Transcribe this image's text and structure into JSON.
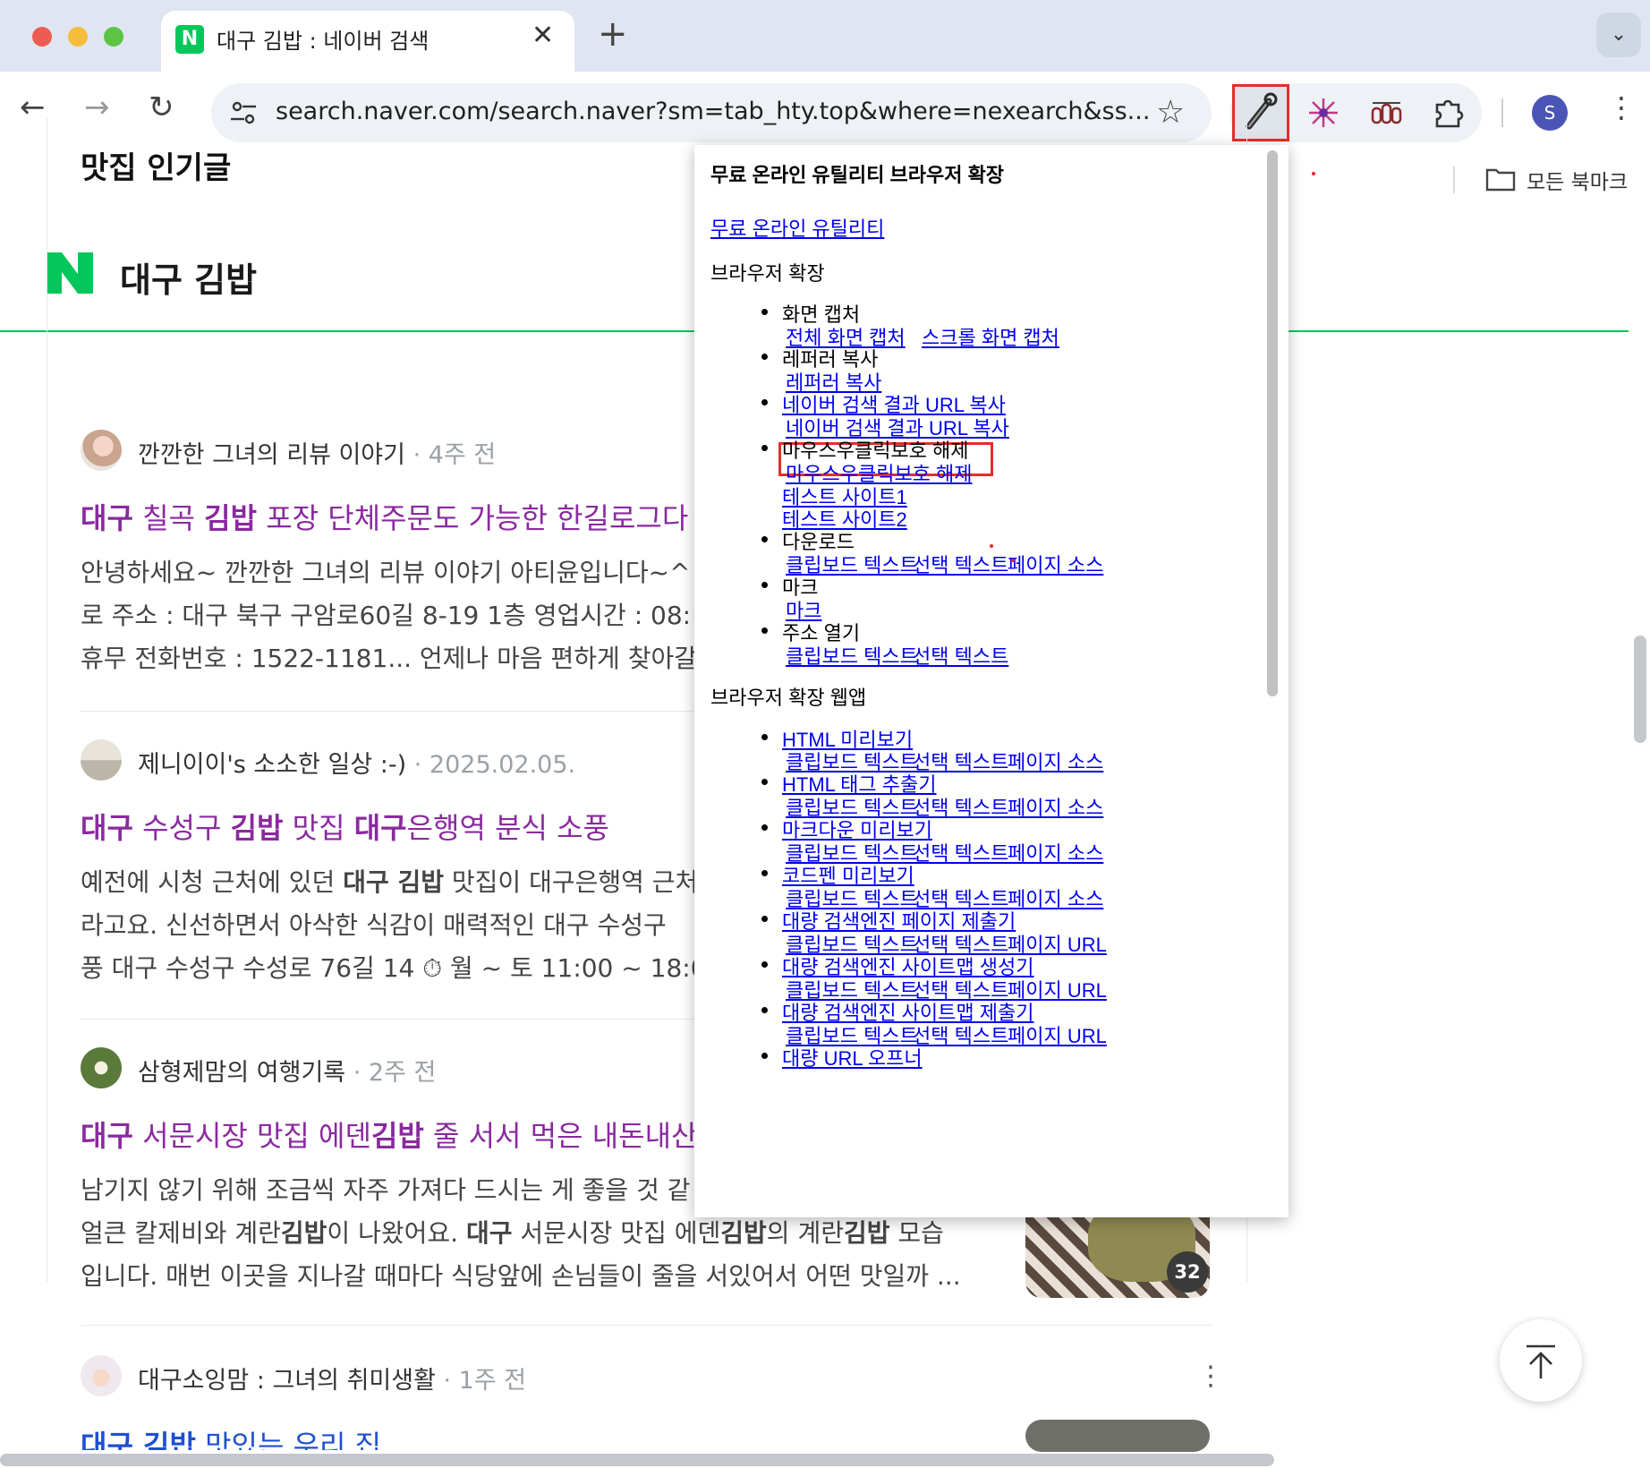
{
  "browser": {
    "tab": {
      "favicon": "N",
      "title": "대구 김밥 : 네이버 검색",
      "close": "✕"
    },
    "new_tab": "+",
    "tab_menu": "⌄",
    "nav": {
      "back": "←",
      "forward": "→",
      "reload": "↻"
    },
    "url": "search.naver.com/search.naver?sm=tab_hty.top&where=nexearch&ss...",
    "star": "☆",
    "profile_initial": "S",
    "menu": "⋮",
    "bookmarks_label": "모든 북마크"
  },
  "page": {
    "query": "대구 김밥",
    "section_title": "맛집 인기글",
    "posts": [
      {
        "author": "깐깐한 그녀의 리뷰 이야기",
        "time": " · 4주 전",
        "title_parts": [
          [
            "b",
            "대구"
          ],
          [
            "t",
            " 칠곡 "
          ],
          [
            "b",
            "김밥"
          ],
          [
            "t",
            " 포장 단체주문도 가능한 한길로그다"
          ]
        ],
        "desc": [
          "안녕하세요~ 깐깐한 그녀의 리뷰 이야기 아티윤입니다~^",
          "로 주소 : 대구 북구 구암로60길 8-19 1층 영업시간 : 08:",
          "휴무 전화번호 : 1522-1181... 언제나 마음 편하게 찾아갈"
        ]
      },
      {
        "author": "제니이이's 소소한 일상 :-)",
        "time": " · 2025.02.05.",
        "title_parts": [
          [
            "b",
            "대구"
          ],
          [
            "t",
            " 수성구 "
          ],
          [
            "b",
            "김밥"
          ],
          [
            "t",
            " 맛집 "
          ],
          [
            "b",
            "대구"
          ],
          [
            "t",
            "은행역 분식 소풍"
          ]
        ],
        "desc": [
          "예전에 시청 근처에 있던 <b>대구 김밥</b> 맛집이 대구은행역 근처",
          "라고요. 신선하면서 아삭한 식감이 매력적인 대구 수성구",
          "풍 대구 수성구 수성로 76길 14 ⏱ 월 ~ 토 11:00 ~ 18:0"
        ]
      },
      {
        "author": "삼형제맘의 여행기록",
        "time": " · 2주 전",
        "title_parts": [
          [
            "b",
            "대구"
          ],
          [
            "t",
            " 서문시장 맛집 에덴"
          ],
          [
            "b",
            "김밥"
          ],
          [
            "t",
            " 줄 서서 먹은 내돈내산"
          ]
        ],
        "desc": [
          "남기지 않기 위해 조금씩 자주 가져다 드시는 게 좋을 것 같",
          "얼큰 칼제비와 계란<b>김밥</b>이 나왔어요. <b>대구</b> 서문시장 맛집 에덴<b>김밥</b>의 계란<b>김밥</b> 모습",
          "입니다. 매번 이곳을 지나갈 때마다 식당앞에 손님들이 줄을 서있어서 어떤 맛일까 ..."
        ]
      },
      {
        "author": "대구소잉맘 : 그녀의 취미생활",
        "time": " · 1주 전",
        "title_parts": [
          [
            "b",
            "대구 김밥"
          ],
          [
            "t",
            " 맛있는 우리 집"
          ]
        ],
        "desc": []
      }
    ],
    "image_count": "32",
    "more": "⋮"
  },
  "popup": {
    "title": "무료 온라인 유틸리티 브라우저 확장",
    "top_link": "무료 온라인 유틸리티",
    "section1": "브라우저 확장",
    "section2": "브라우저 확장 웹앱",
    "s1": {
      "capture": "화면 캡처",
      "capture_full": "전체 화면 캡처",
      "capture_scroll": "스크롤 화면 캡처",
      "referrer": "레퍼러 복사",
      "referrer_link": "레퍼러 복사",
      "naver_url": "네이버 검색 결과 URL 복사",
      "naver_url_link": "네이버 검색 결과 URL 복사",
      "mouse": "마우스우클릭보호 해제",
      "mouse_link": "마우스우클릭보호 해제",
      "test1": "테스트 사이트1",
      "test2": "테스트 사이트2",
      "download": "다운로드",
      "mark": "마크",
      "mark_link": "마크",
      "open": "주소 열기",
      "clip": "클립보드 텍스트",
      "sel": "선택 텍스트",
      "src": "페이지 소스"
    },
    "s2": {
      "html_preview": "HTML 미리보기",
      "html_tag": "HTML 태그 추출기",
      "md_preview": "마크다운 미리보기",
      "codepen": "코드펜 미리보기",
      "bulk_submit": "대량 검색엔진 페이지 제출기",
      "sitemap_gen": "대량 검색엔진 사이트맵 생성기",
      "sitemap_submit": "대량 검색엔진 사이트맵 제출기",
      "url_opener": "대량 URL 오프너",
      "clip": "클립보드 텍스트",
      "sel": "선택 텍스트",
      "src": "페이지 소스",
      "purl": "페이지 URL"
    }
  }
}
